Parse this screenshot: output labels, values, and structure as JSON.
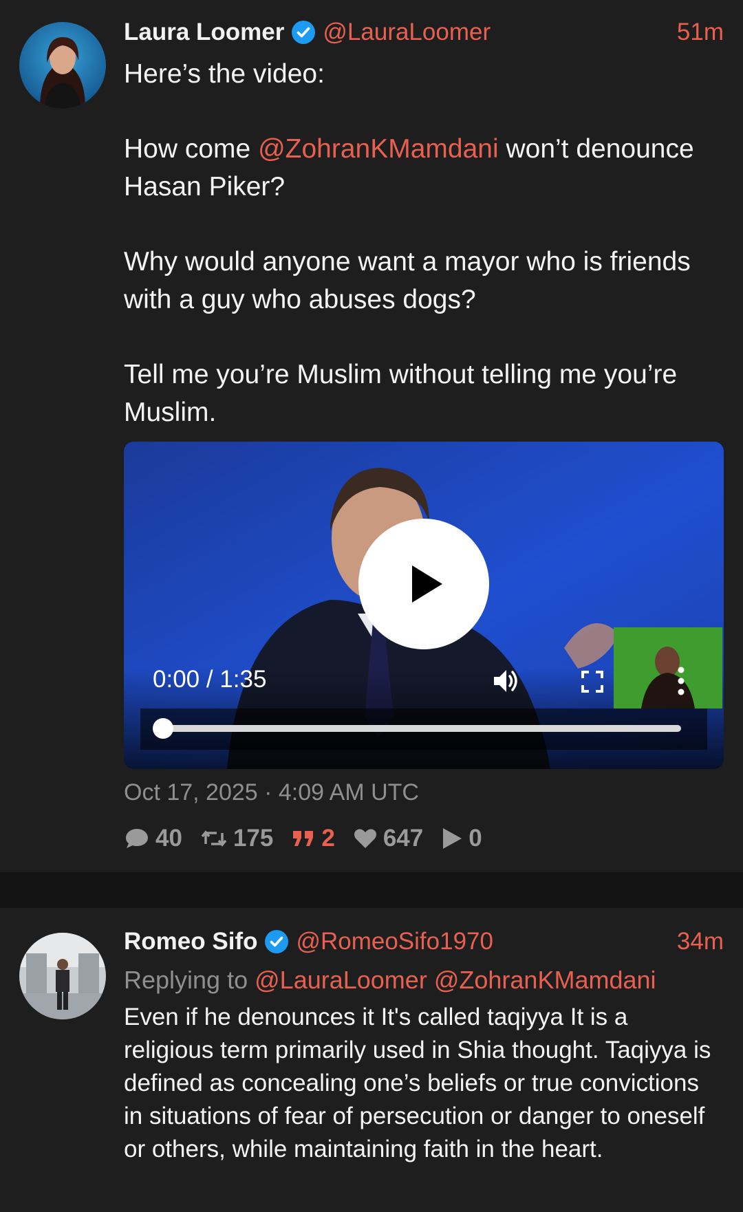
{
  "main_tweet": {
    "name": "Laura Loomer",
    "handle": "@LauraLoomer",
    "time": "51m",
    "paragraphs": [
      {
        "text": "Here’s the video:"
      },
      {
        "before": "How come ",
        "mention": "@ZohranKMamdani",
        "after": " won’t denounce Hasan Piker?"
      },
      {
        "text": "Why would anyone want a mayor who is friends with a guy who abuses dogs?"
      },
      {
        "text": "Tell me you’re Muslim without telling me you’re Muslim."
      }
    ],
    "video": {
      "time_label": "0:00 / 1:35",
      "progress": 0.0
    },
    "date": "Oct 17, 2025 · 4:09 AM UTC",
    "stats": {
      "replies": "40",
      "retweets": "175",
      "quotes": "2",
      "likes": "647",
      "plays": "0"
    }
  },
  "reply_tweet": {
    "name": "Romeo Sifo",
    "handle": "@RomeoSifo1970",
    "time": "34m",
    "replying_label": "Replying to",
    "replying_to": [
      "@LauraLoomer",
      "@ZohranKMamdani"
    ],
    "text": "Even if he denounces it It's called taqiyya It is a religious term primarily used in Shia thought. Taqiyya is defined as concealing one’s beliefs or true convictions in situations of fear of persecution or danger to oneself or others, while maintaining faith in the heart."
  },
  "colors": {
    "accent": "#e8604f",
    "background": "#1e1e1e",
    "muted": "#8f8f8f",
    "verified": "#1d9bf0"
  },
  "icons": [
    "verified-badge-icon",
    "play-icon",
    "volume-icon",
    "fullscreen-icon",
    "more-vertical-icon",
    "comment-icon",
    "retweet-icon",
    "quote-icon",
    "heart-icon",
    "play-count-icon"
  ]
}
